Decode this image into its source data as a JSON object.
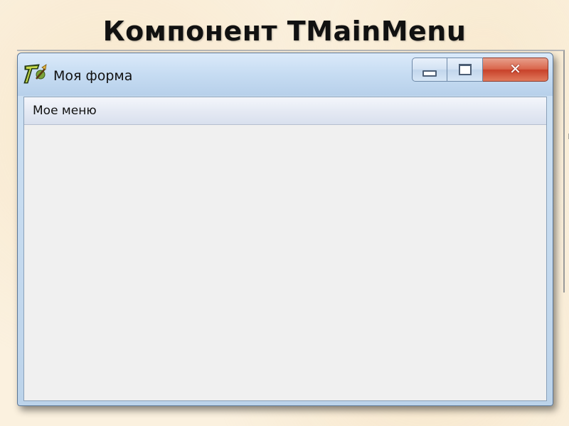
{
  "slide": {
    "title": "Компонент TMainMenu"
  },
  "window": {
    "title": "Моя форма",
    "icon": "delphi-app-icon",
    "caption_buttons": {
      "minimize_icon": "minimize-icon",
      "maximize_icon": "maximize-icon",
      "close_icon": "close-icon"
    }
  },
  "menubar": {
    "items": [
      {
        "label": "Мое меню"
      }
    ]
  },
  "colors": {
    "slide_background": "#fbf1df",
    "titlebar": "#c6dcf2",
    "close_button": "#d9654b",
    "client_area": "#f0f0f0"
  }
}
